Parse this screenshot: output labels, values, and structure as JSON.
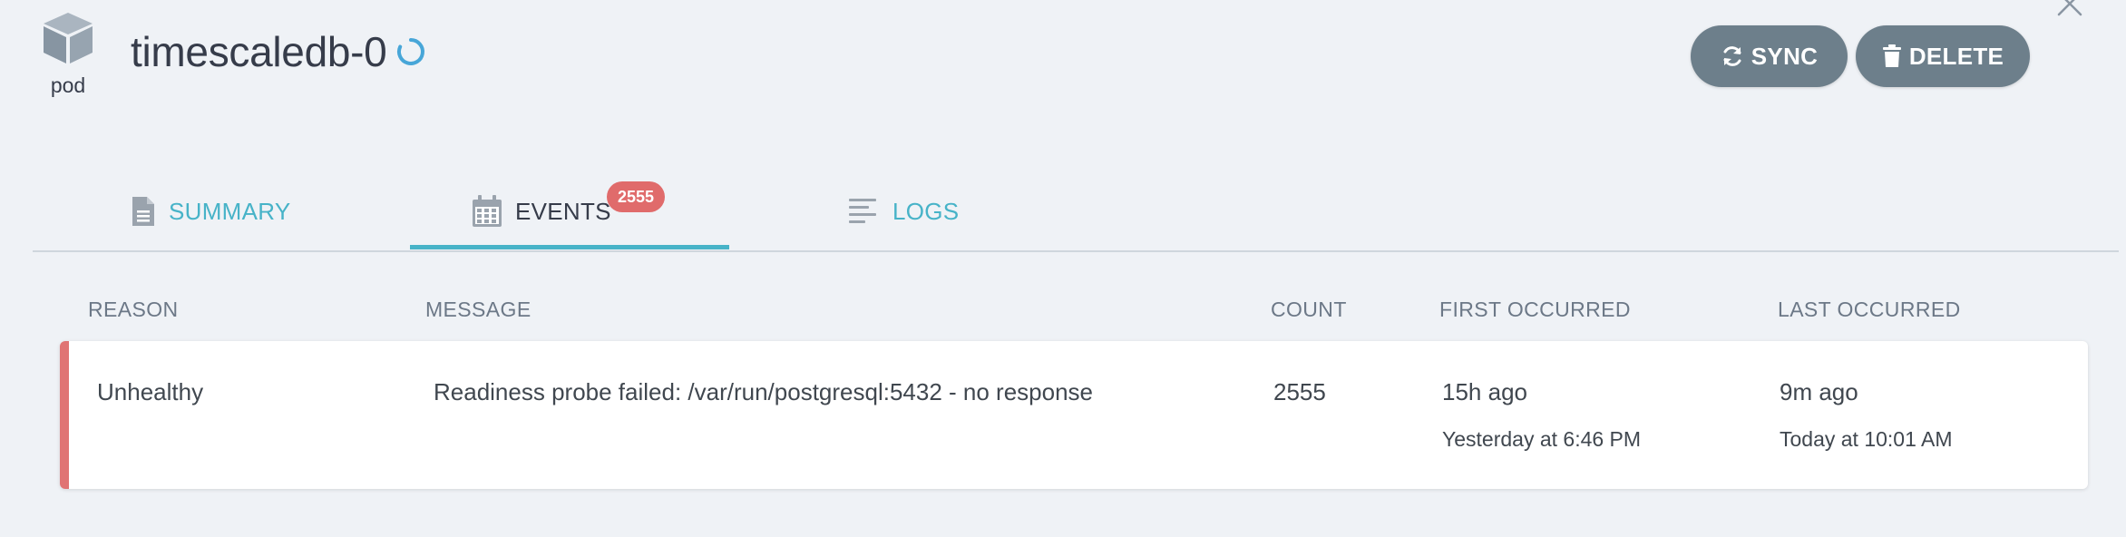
{
  "header": {
    "kind_label": "pod",
    "title": "timescaledb-0",
    "sync_label": "SYNC",
    "delete_label": "DELETE"
  },
  "tabs": [
    {
      "label": "SUMMARY",
      "icon": "file-text-icon",
      "active": false
    },
    {
      "label": "EVENTS",
      "icon": "calendar-icon",
      "active": true,
      "badge": "2555"
    },
    {
      "label": "LOGS",
      "icon": "align-left-icon",
      "active": false
    }
  ],
  "events_table": {
    "columns": [
      "REASON",
      "MESSAGE",
      "COUNT",
      "FIRST OCCURRED",
      "LAST OCCURRED"
    ],
    "rows": [
      {
        "reason": "Unhealthy",
        "message": "Readiness probe failed: /var/run/postgresql:5432 - no response",
        "count": "2555",
        "first_relative": "15h ago",
        "first_absolute": "Yesterday at 6:46 PM",
        "last_relative": "9m ago",
        "last_absolute": "Today at 10:01 AM"
      }
    ]
  },
  "colors": {
    "accent": "#47b3c8",
    "button_bg": "#6d7f8b",
    "badge_bg": "#e06b6b",
    "error_stripe": "#e07474",
    "page_bg": "#eff2f6"
  }
}
